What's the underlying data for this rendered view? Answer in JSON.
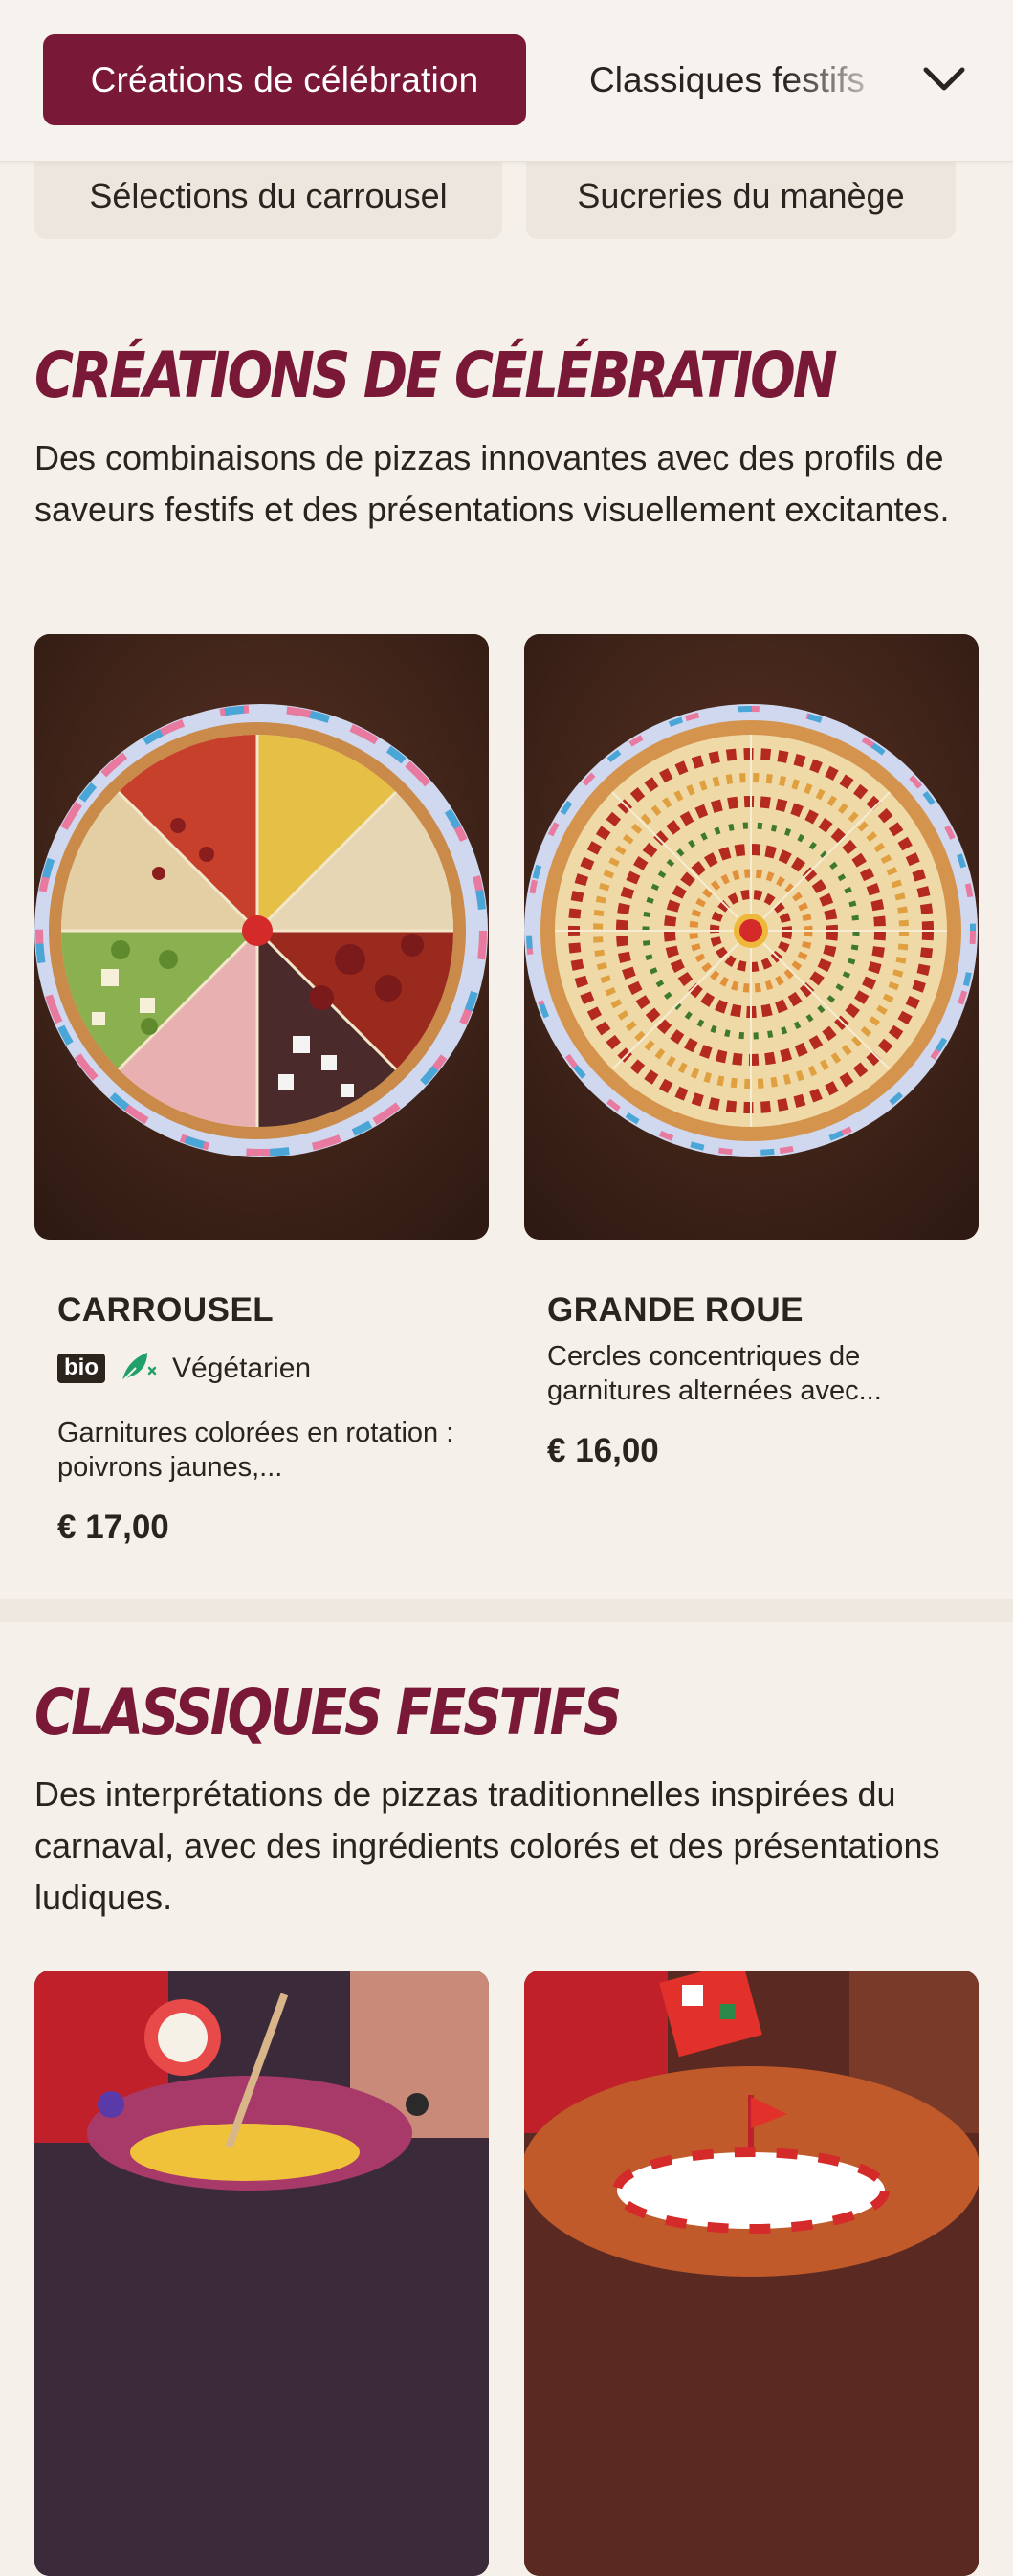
{
  "nav": {
    "active_tab": "Créations de célébration",
    "next_tab": "Classiques festifs",
    "chips": [
      "Sélections du carrousel",
      "Sucreries du manège"
    ]
  },
  "sections": [
    {
      "title": "Créations de célébration",
      "description": "Des combinaisons de pizzas innovantes avec des profils de saveurs festifs et des présentations visuellement excitantes.",
      "items": [
        {
          "name": "CARROUSEL",
          "badge_bio": "bio",
          "diet_label": "Végétarien",
          "description": "Garnitures colorées en rotation : poivrons jaunes,...",
          "price": "€ 17,00"
        },
        {
          "name": "GRANDE ROUE",
          "description": "Cercles concentriques de garnitures alternées avec...",
          "price": "€ 16,00"
        }
      ]
    },
    {
      "title": "Classiques festifs",
      "description": "Des interprétations de pizzas traditionnelles inspirées du carnaval, avec des ingrédients colorés et des présentations ludiques."
    }
  ],
  "icons": {
    "dropdown": "chevron-down-icon",
    "vegetarian": "leaf-icon"
  },
  "colors": {
    "brand": "#7a1838",
    "background": "#f5f1ea",
    "vegetarian": "#22a06b"
  }
}
